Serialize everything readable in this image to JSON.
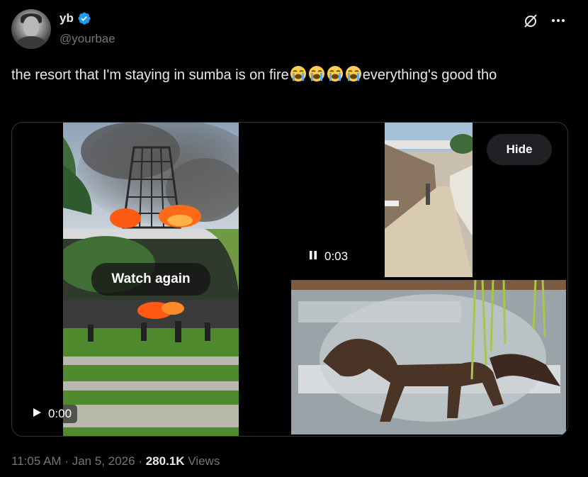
{
  "author": {
    "display_name": "yb",
    "handle": "@yourbae"
  },
  "tweet": {
    "text_before": "the resort that I'm staying in sumba is on fire",
    "emoji_name": "loudly-crying-face",
    "emoji_count": 4,
    "text_after": "everything's good tho"
  },
  "media": {
    "watch_again_label": "Watch again",
    "hide_label": "Hide",
    "video1_time": "0:00",
    "video2_time": "0:03"
  },
  "footer": {
    "time": "11:05 AM",
    "date": "Jan 5, 2026",
    "views_count": "280.1K",
    "views_label": "Views",
    "separator": "·"
  },
  "colors": {
    "background": "#000000",
    "text": "#e7e9ea",
    "muted": "#71767b",
    "verified": "#1d9bf0",
    "border": "#333639"
  },
  "icons": [
    "verified-badge-icon",
    "grok-icon",
    "more-icon",
    "play-icon",
    "pause-icon",
    "crying-face-emoji"
  ]
}
